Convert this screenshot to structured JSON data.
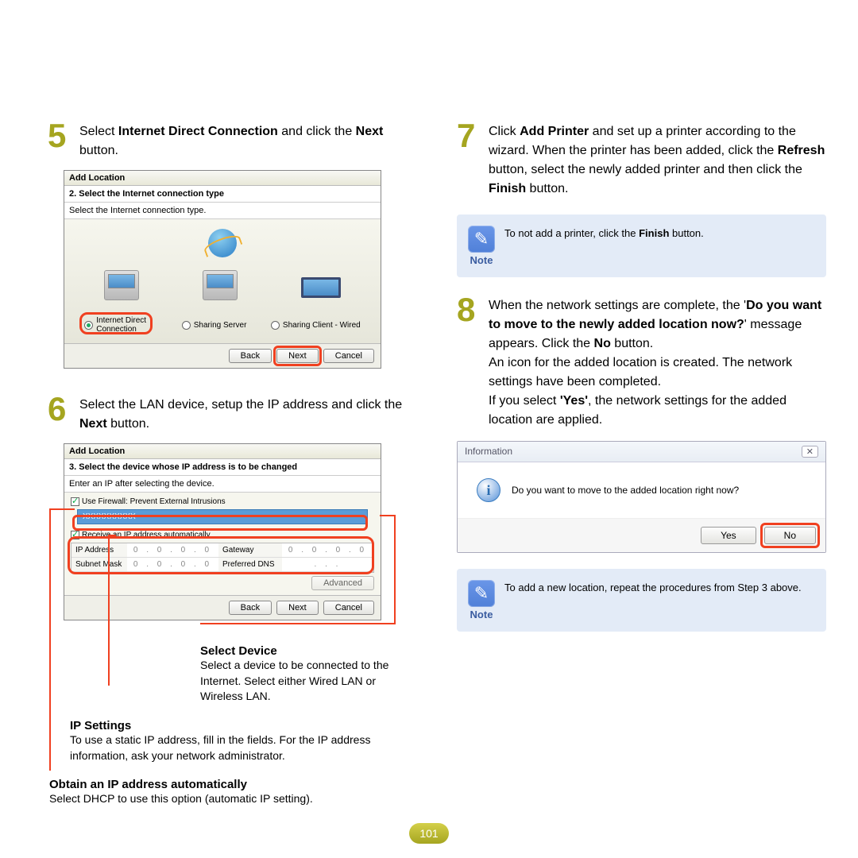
{
  "steps": {
    "s5": {
      "num": "5",
      "text_before": "Select ",
      "b1": "Internet Direct Connection",
      "mid": " and click the ",
      "b2": "Next",
      "after": " button."
    },
    "s6": {
      "num": "6",
      "text": "Select the LAN device, setup the IP address and click the ",
      "b": "Next",
      "after": " button."
    },
    "s7": {
      "num": "7",
      "p1a": "Click ",
      "b1": "Add Printer",
      "p1b": " and set up a printer according to the wizard. When the printer has been added, click the ",
      "b2": "Refresh",
      "p1c": " button, select the newly added printer and then click the ",
      "b3": "Finish",
      "p1d": " button."
    },
    "s8": {
      "num": "8",
      "l1a": "When the network settings are complete, the '",
      "b1": "Do you want to move to the newly added location now?",
      "l1b": "' message appears. Click the ",
      "b2": "No",
      "l1c": " button.",
      "l2": "An icon for the added location is created. The network settings have been completed.",
      "l3a": "If you select ",
      "b3": "'Yes'",
      "l3b": ", the network settings for the added location are applied."
    }
  },
  "win1": {
    "title": "Add Location",
    "sub": "2. Select the Internet connection type",
    "desc": "Select the Internet connection type.",
    "opt1": "Internet Direct Connection",
    "opt2": "Sharing Server",
    "opt3": "Sharing Client - Wired",
    "back": "Back",
    "next": "Next",
    "cancel": "Cancel"
  },
  "win2": {
    "title": "Add Location",
    "sub": "3. Select the device whose IP address is to be changed",
    "desc": "Enter an IP after selecting the device.",
    "firewall": "Use Firewall: Prevent External Intrusions",
    "device": "XXXXXXXXXX",
    "auto": "Receive an IP address automatically",
    "ip_lbl": "IP Address",
    "ip": "0 . 0 . 0 . 0",
    "gw_lbl": "Gateway",
    "gw": "0 . 0 . 0 . 0",
    "sn_lbl": "Subnet Mask",
    "sn": "0 . 0 . 0 . 0",
    "dns_lbl": "Preferred DNS",
    "dns": ". . .",
    "advanced": "Advanced",
    "back": "Back",
    "next": "Next",
    "cancel": "Cancel"
  },
  "annot": {
    "sd_head": "Select Device",
    "sd_text": "Select a device to be connected to the Internet. Select either Wired LAN or Wireless LAN.",
    "ip_head": "IP Settings",
    "ip_text": "To use a static IP address, fill in the fields. For the IP address information, ask your network administrator.",
    "ob_head": "Obtain an IP address automatically",
    "ob_text": "Select DHCP to use this option (automatic IP setting)."
  },
  "notes": {
    "label": "Note",
    "n1a": "To not add a printer, click the ",
    "n1b": "Finish",
    "n1c": " button.",
    "n2": "To add a new location, repeat the procedures from Step 3 above."
  },
  "dialog": {
    "title": "Information",
    "msg": "Do you want to move to the added location right now?",
    "yes": "Yes",
    "no": "No",
    "x": "✕"
  },
  "page": "101"
}
